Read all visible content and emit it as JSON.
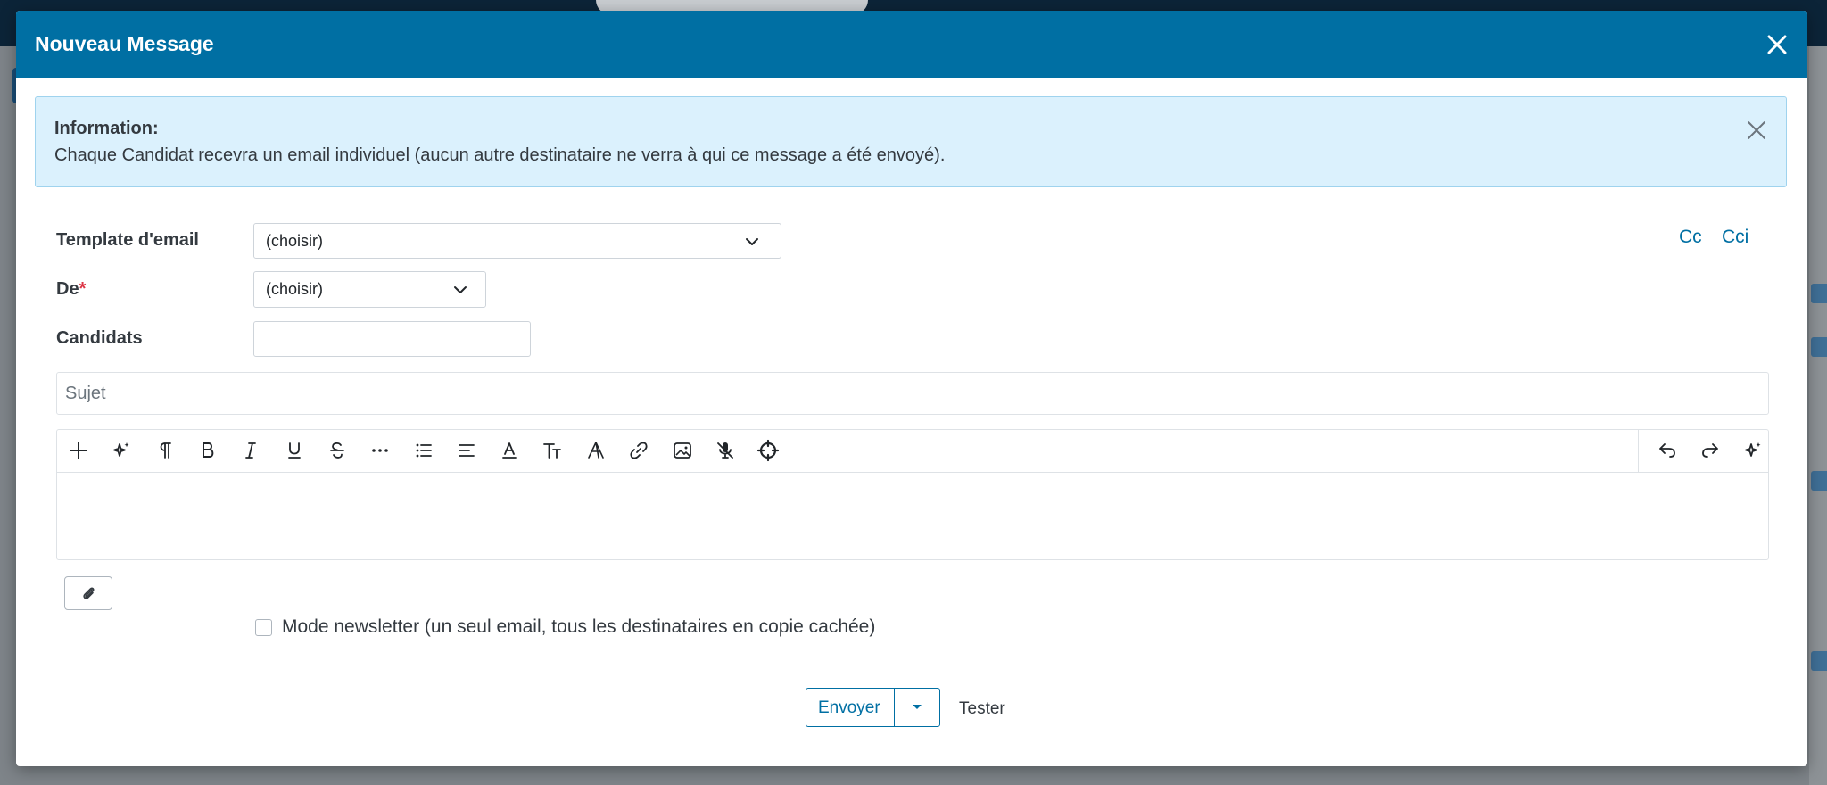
{
  "modal": {
    "title": "Nouveau Message"
  },
  "alert": {
    "title": "Information:",
    "text": "Chaque Candidat recevra un email individuel (aucun autre destinataire ne verra à qui ce message a été envoyé)."
  },
  "form": {
    "template_label": "Template d'email",
    "template_value": "(choisir)",
    "from_label": "De",
    "from_required": "*",
    "from_value": "(choisir)",
    "candidates_label": "Candidats",
    "candidates_value": "",
    "cc_label": "Cc",
    "bcc_label": "Cci",
    "subject_placeholder": "Sujet"
  },
  "editor": {
    "toolbar_icons": [
      "plus-icon",
      "sparkle-icon",
      "paragraph-icon",
      "bold-icon",
      "italic-icon",
      "underline-icon",
      "strikethrough-icon",
      "more-icon",
      "list-icon",
      "align-icon",
      "font-color-icon",
      "text-size-icon",
      "font-family-icon",
      "link-icon",
      "image-icon",
      "mic-off-icon",
      "crosshair-icon"
    ],
    "toolbar_right_icons": [
      "undo-icon",
      "redo-icon",
      "ai-sparkle-icon"
    ]
  },
  "newsletter": {
    "label": "Mode newsletter (un seul email, tous les destinataires en copie cachée)",
    "checked": false
  },
  "actions": {
    "send_label": "Envoyer",
    "test_label": "Tester"
  },
  "colors": {
    "primary": "#006fa3",
    "alert_bg": "#dbf1fd",
    "required": "#dc3545"
  }
}
